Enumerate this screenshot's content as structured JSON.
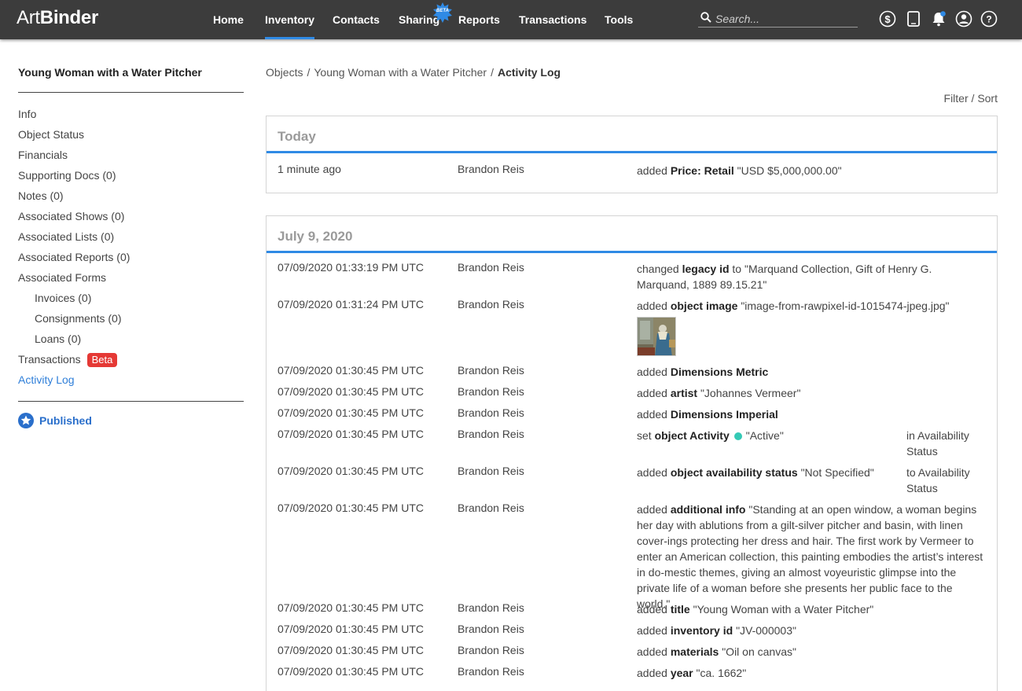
{
  "app": {
    "logo_light": "Art",
    "logo_bold": "Binder"
  },
  "nav": {
    "items": [
      {
        "label": "Home"
      },
      {
        "label": "Inventory"
      },
      {
        "label": "Contacts"
      },
      {
        "label": "Sharing"
      },
      {
        "label": "Reports"
      },
      {
        "label": "Transactions"
      },
      {
        "label": "Tools"
      }
    ],
    "active": "Inventory",
    "sharing_badge": "BETA",
    "accent_color": "#2f8ae5"
  },
  "search": {
    "placeholder": "Search..."
  },
  "header_icons": [
    "dollar-icon",
    "tablet-icon",
    "bell-icon",
    "user-icon",
    "help-icon"
  ],
  "sidebar": {
    "title": "Young Woman with a Water Pitcher",
    "items": [
      {
        "label": "Info"
      },
      {
        "label": "Object Status"
      },
      {
        "label": "Financials"
      },
      {
        "label": "Supporting Docs (0)"
      },
      {
        "label": "Notes (0)"
      },
      {
        "label": "Associated Shows (0)"
      },
      {
        "label": "Associated Lists (0)"
      },
      {
        "label": "Associated Reports (0)"
      },
      {
        "label": "Associated Forms"
      },
      {
        "label": "Invoices (0)"
      },
      {
        "label": "Consignments (0)"
      },
      {
        "label": "Loans (0)"
      },
      {
        "label": "Transactions"
      },
      {
        "label": "Activity Log"
      }
    ],
    "transactions_badge": "Beta",
    "active": "Activity Log",
    "published_label": "Published"
  },
  "breadcrumb": {
    "items": [
      "Objects",
      "Young Woman with a Water Pitcher"
    ],
    "current": "Activity Log"
  },
  "filter_sort": {
    "filter": "Filter",
    "sort": "Sort"
  },
  "log": {
    "today": {
      "heading": "Today",
      "entries": [
        {
          "date": "1 minute ago",
          "user": "Brandon Reis",
          "action": "added",
          "field": "Price: Retail",
          "value": "\"USD $5,000,000.00\""
        }
      ]
    },
    "july": {
      "heading": "July 9, 2020",
      "entries": [
        {
          "date": "07/09/2020 01:33:19 PM UTC",
          "user": "Brandon Reis",
          "action": "changed",
          "field": "legacy id",
          "value": "to \"Marquand Collection, Gift of Henry G. Marquand, 1889 89.15.21\""
        },
        {
          "date": "07/09/2020 01:31:24 PM UTC",
          "user": "Brandon Reis",
          "action": "added",
          "field": "object image",
          "value": "\"image-from-rawpixel-id-1015474-jpeg.jpg\""
        },
        {
          "date": "07/09/2020 01:30:45 PM UTC",
          "user": "Brandon Reis",
          "action": "added",
          "field": "Dimensions Metric",
          "value": ""
        },
        {
          "date": "07/09/2020 01:30:45 PM UTC",
          "user": "Brandon Reis",
          "action": "added",
          "field": "artist",
          "value": "\"Johannes Vermeer\""
        },
        {
          "date": "07/09/2020 01:30:45 PM UTC",
          "user": "Brandon Reis",
          "action": "added",
          "field": "Dimensions Imperial",
          "value": ""
        },
        {
          "date": "07/09/2020 01:30:45 PM UTC",
          "user": "Brandon Reis",
          "action": "set",
          "field": "object Activity",
          "value": "\"Active\"",
          "extra": "in Availability Status",
          "status_color": "#34c9b5"
        },
        {
          "date": "07/09/2020 01:30:45 PM UTC",
          "user": "Brandon Reis",
          "action": "added",
          "field": "object availability status",
          "value": "\"Not Specified\"",
          "extra": "to Availability Status"
        },
        {
          "date": "07/09/2020 01:30:45 PM UTC",
          "user": "Brandon Reis",
          "action": "added",
          "field": "additional info",
          "value": "\"Standing at an open window, a woman begins her day with ablutions from a gilt-silver pitcher and basin, with linen cover-ings protecting her dress and hair. The first work by Vermeer to enter an American collection, this painting embodies the artist’s interest in do-mestic themes, giving an almost voyeuristic glimpse into the private life of a woman before she presents her public face to the world.\""
        },
        {
          "date": "07/09/2020 01:30:45 PM UTC",
          "user": "Brandon Reis",
          "action": "added",
          "field": "title",
          "value": "\"Young Woman with a Water Pitcher\""
        },
        {
          "date": "07/09/2020 01:30:45 PM UTC",
          "user": "Brandon Reis",
          "action": "added",
          "field": "inventory id",
          "value": "\"JV-000003\""
        },
        {
          "date": "07/09/2020 01:30:45 PM UTC",
          "user": "Brandon Reis",
          "action": "added",
          "field": "materials",
          "value": "\"Oil on canvas\""
        },
        {
          "date": "07/09/2020 01:30:45 PM UTC",
          "user": "Brandon Reis",
          "action": "added",
          "field": "year",
          "value": "\"ca. 1662\""
        }
      ]
    }
  }
}
